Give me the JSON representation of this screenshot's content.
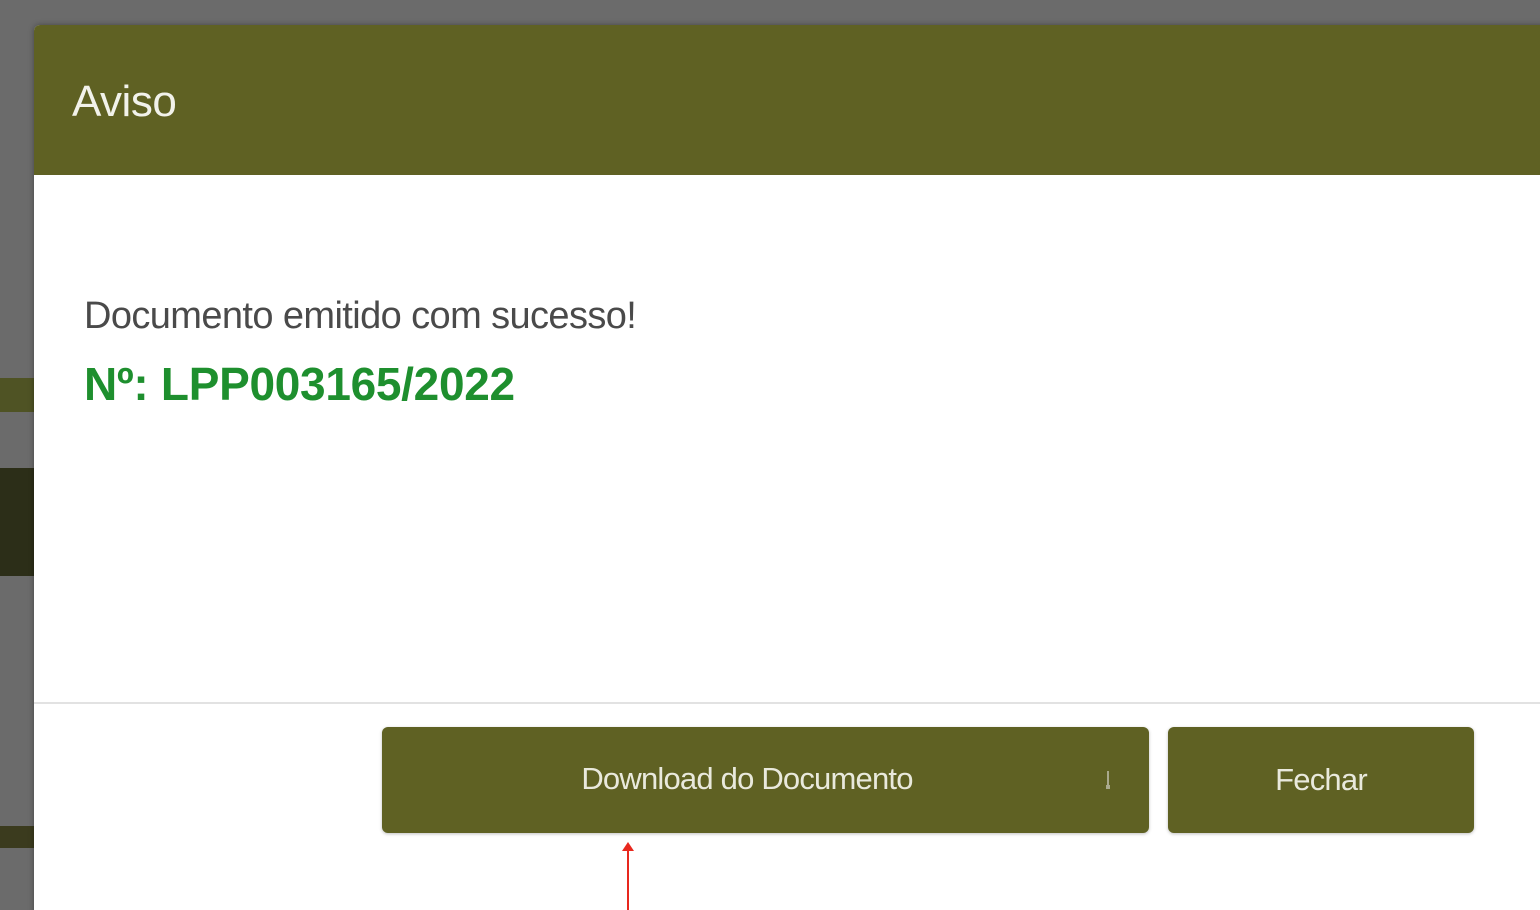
{
  "modal": {
    "title": "Aviso",
    "message": "Documento emitido com sucesso!",
    "document_number": "Nº: LPP003165/2022"
  },
  "buttons": {
    "download_label": "Download do Documento",
    "download_icon": "download-icon",
    "close_label": "Fechar"
  },
  "colors": {
    "header": "#5f6123",
    "button": "#5f6123",
    "number": "#1e8f2e",
    "annotation": "#e8281e"
  }
}
